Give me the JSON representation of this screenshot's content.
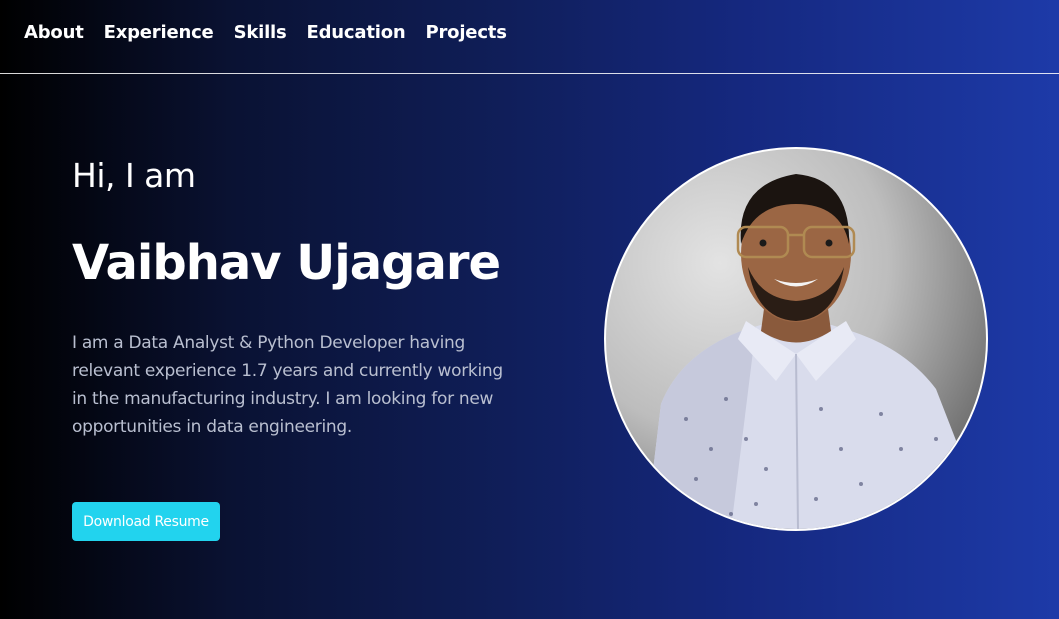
{
  "nav": {
    "items": [
      {
        "label": "About"
      },
      {
        "label": "Experience"
      },
      {
        "label": "Skills"
      },
      {
        "label": "Education"
      },
      {
        "label": "Projects"
      }
    ]
  },
  "hero": {
    "greeting": "Hi, I am",
    "name": "Vaibhav Ujagare",
    "bio": "I am a Data Analyst & Python Developer having relevant experience 1.7 years and currently working in the manufacturing industry. I am looking for new opportunities in data engineering.",
    "resume_button": "Download Resume"
  },
  "colors": {
    "accent": "#22d3ee",
    "gradient_start": "#000000",
    "gradient_end": "#1d3aa8",
    "bio_text": "#b9bfd0"
  },
  "profile_photo": {
    "icon": "profile-photo"
  }
}
